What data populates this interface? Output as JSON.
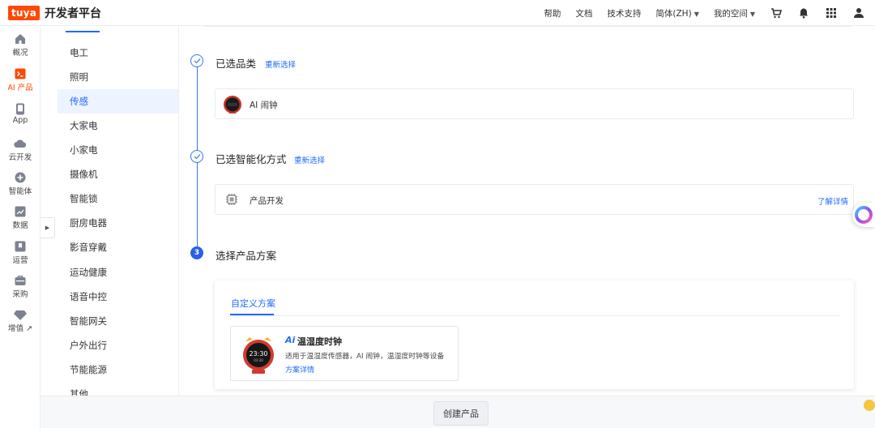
{
  "header": {
    "logo_text": "tuya",
    "brand": "开发者平台",
    "nav": {
      "help": "帮助",
      "docs": "文档",
      "support": "技术支持",
      "language": "简体(ZH)",
      "space": "我的空间"
    },
    "icons": [
      "cart-icon",
      "bell-icon",
      "grid-apps-icon",
      "user-icon"
    ]
  },
  "rail": {
    "items": [
      {
        "label": "概况",
        "icon": "home-icon"
      },
      {
        "label": "AI 产品",
        "icon": "terminal-icon"
      },
      {
        "label": "App",
        "icon": "phone-icon"
      },
      {
        "label": "云开发",
        "icon": "cloud-icon"
      },
      {
        "label": "智能体",
        "icon": "agent-icon"
      },
      {
        "label": "数据",
        "icon": "chart-icon"
      },
      {
        "label": "运营",
        "icon": "bookmark-icon"
      },
      {
        "label": "采购",
        "icon": "cart-box-icon"
      },
      {
        "label": "增值 ↗",
        "icon": "diamond-icon"
      }
    ],
    "active_color": "#ff4800"
  },
  "categories": [
    "电工",
    "照明",
    "传感",
    "大家电",
    "小家电",
    "摄像机",
    "智能锁",
    "厨房电器",
    "影音穿戴",
    "运动健康",
    "语音中控",
    "智能网关",
    "户外出行",
    "节能能源",
    "其他"
  ],
  "active_category": "传感",
  "steps": {
    "step1": {
      "title": "已选品类",
      "reselect": "重新选择",
      "selected": "AI 闹钟"
    },
    "step2": {
      "title": "已选智能化方式",
      "reselect": "重新选择",
      "selected": "产品开发",
      "detail": "了解详情"
    },
    "step3": {
      "number": "3",
      "title": "选择产品方案"
    }
  },
  "plan": {
    "tab": "自定义方案",
    "card": {
      "ai_badge": "Ai",
      "name": "温湿度时钟",
      "desc": "适用于温湿度传感器，AI 闹钟，温湿度时钟等设备",
      "link": "方案详情",
      "clock_time": "23:30",
      "clock_sub": "03:30"
    }
  },
  "footer": {
    "create_button": "创建产品"
  },
  "colors": {
    "accent": "#1e6bff",
    "brand": "#ff4800"
  }
}
